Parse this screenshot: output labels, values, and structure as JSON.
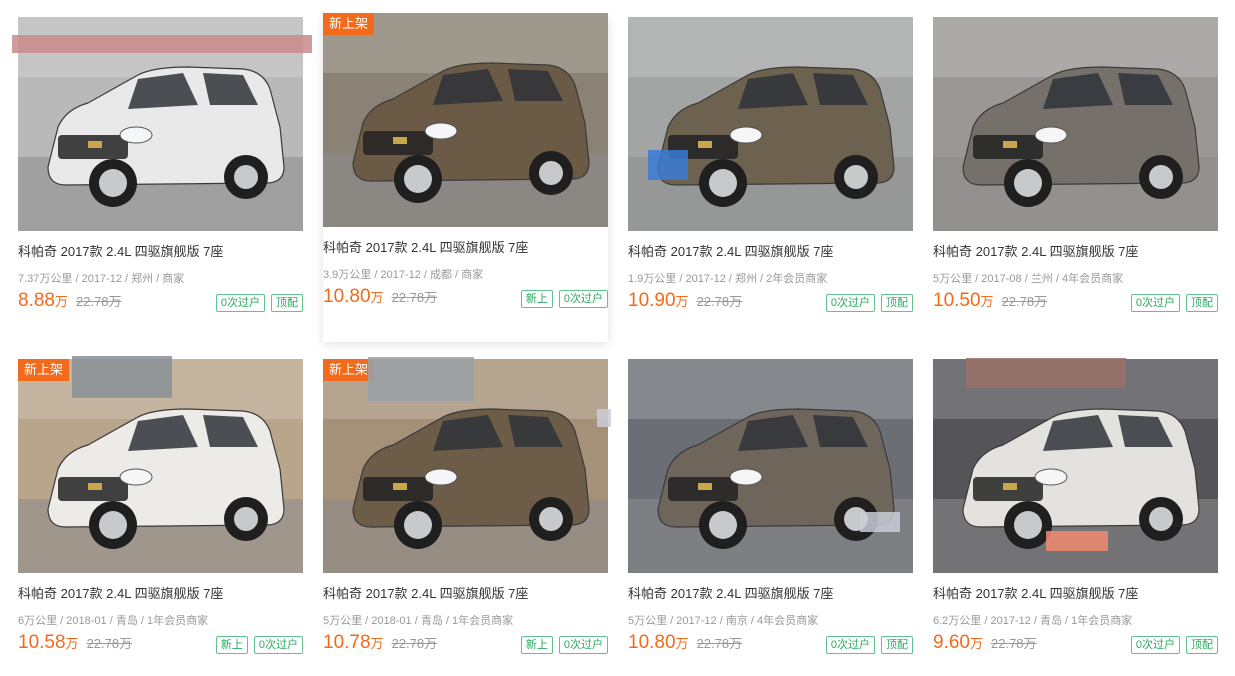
{
  "listings": [
    {
      "tag": "",
      "title": "科帕奇 2017款 2.4L 四驱旗舰版 7座",
      "meta": "7.37万公里 / 2017-12 / 郑州 / 商家",
      "price": "8.88",
      "unit": "万",
      "original": "22.78万",
      "badges": [
        "0次过户",
        "顶配"
      ],
      "car_color": "#e9e9ea",
      "bg_color": "#b9b9b9"
    },
    {
      "tag": "新上架",
      "title": "科帕奇 2017款 2.4L 四驱旗舰版 7座",
      "meta": "3.9万公里 / 2017-12 / 成都 / 商家",
      "price": "10.80",
      "unit": "万",
      "original": "22.78万",
      "badges": [
        "新上",
        "0次过户"
      ],
      "car_color": "#6b5a45",
      "bg_color": "#8a8275"
    },
    {
      "tag": "",
      "title": "科帕奇 2017款 2.4L 四驱旗舰版 7座",
      "meta": "1.9万公里 / 2017-12 / 郑州 / 2年会员商家",
      "price": "10.90",
      "unit": "万",
      "original": "22.78万",
      "badges": [
        "0次过户",
        "顶配"
      ],
      "car_color": "#6d6150",
      "bg_color": "#a3a4a4"
    },
    {
      "tag": "",
      "title": "科帕奇 2017款 2.4L 四驱旗舰版 7座",
      "meta": "5万公里 / 2017-08 / 兰州 / 4年会员商家",
      "price": "10.50",
      "unit": "万",
      "original": "22.78万",
      "badges": [
        "0次过户",
        "顶配"
      ],
      "car_color": "#75706a",
      "bg_color": "#9a9796"
    },
    {
      "tag": "新上架",
      "title": "科帕奇 2017款 2.4L 四驱旗舰版 7座",
      "meta": "6万公里 / 2018-01 / 青岛 / 1年会员商家",
      "price": "10.58",
      "unit": "万",
      "original": "22.78万",
      "badges": [
        "新上",
        "0次过户"
      ],
      "car_color": "#ecebe8",
      "bg_color": "#b9a48c"
    },
    {
      "tag": "新上架",
      "title": "科帕奇 2017款 2.4L 四驱旗舰版 7座",
      "meta": "5万公里 / 2018-01 / 青岛 / 1年会员商家",
      "price": "10.78",
      "unit": "万",
      "original": "22.78万",
      "badges": [
        "新上",
        "0次过户"
      ],
      "car_color": "#6c5c48",
      "bg_color": "#a59078"
    },
    {
      "tag": "",
      "title": "科帕奇 2017款 2.4L 四驱旗舰版 7座",
      "meta": "5万公里 / 2017-12 / 南京 / 4年会员商家",
      "price": "10.80",
      "unit": "万",
      "original": "22.78万",
      "badges": [
        "0次过户",
        "顶配"
      ],
      "car_color": "#6f665b",
      "bg_color": "#6b6f75"
    },
    {
      "tag": "",
      "title": "科帕奇 2017款 2.4L 四驱旗舰版 7座",
      "meta": "6.2万公里 / 2017-12 / 青岛 / 1年会员商家",
      "price": "9.60",
      "unit": "万",
      "original": "22.78万",
      "badges": [
        "0次过户",
        "顶配"
      ],
      "car_color": "#e3e2df",
      "bg_color": "#555559"
    }
  ],
  "colors": {
    "accent": "#f26a1b",
    "badge_green": "#2aa860",
    "muted": "#999999"
  }
}
